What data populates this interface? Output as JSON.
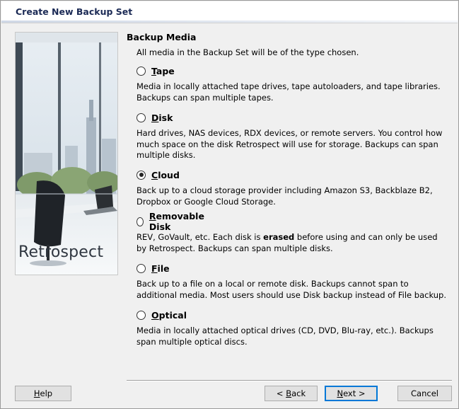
{
  "window": {
    "title": "Create New Backup Set"
  },
  "brand": {
    "name": "Retrospect"
  },
  "section": {
    "heading": "Backup Media",
    "intro": "All media in the Backup Set will be of the type chosen."
  },
  "options": [
    {
      "key": "tape",
      "mnemonic": "T",
      "rest": "ape",
      "checked": false,
      "description": "Media in locally attached tape drives, tape autoloaders, and tape libraries. Backups can span multiple tapes."
    },
    {
      "key": "disk",
      "mnemonic": "D",
      "rest": "isk",
      "checked": false,
      "description": "Hard drives, NAS devices, RDX devices, or remote servers. You control how much space on the disk Retrospect will use for storage. Backups can span multiple disks."
    },
    {
      "key": "cloud",
      "mnemonic": "C",
      "rest": "loud",
      "checked": true,
      "description": "Back up to a cloud storage provider including Amazon S3, Backblaze B2, Dropbox or Google Cloud Storage."
    },
    {
      "key": "removable",
      "mnemonic": "R",
      "rest": "emovable Disk",
      "checked": false,
      "description_before": "REV, GoVault, etc. Each disk is ",
      "description_bold": "erased",
      "description_after": " before using and can only be used by Retrospect. Backups can span multiple disks."
    },
    {
      "key": "file",
      "mnemonic": "F",
      "rest": "ile",
      "checked": false,
      "description": "Back up to a file on a local or remote disk. Backups cannot span to additional media. Most users should use Disk backup instead of File backup."
    },
    {
      "key": "optical",
      "mnemonic": "O",
      "rest": "ptical",
      "checked": false,
      "description": "Media in locally attached optical drives (CD, DVD, Blu-ray, etc.). Backups span multiple optical discs."
    }
  ],
  "buttons": {
    "help": {
      "mnemonic": "H",
      "rest": "elp"
    },
    "back": {
      "prefix": "< ",
      "mnemonic": "B",
      "rest": "ack"
    },
    "next": {
      "mnemonic": "N",
      "rest": "ext >"
    },
    "cancel": {
      "label": "Cancel"
    }
  }
}
